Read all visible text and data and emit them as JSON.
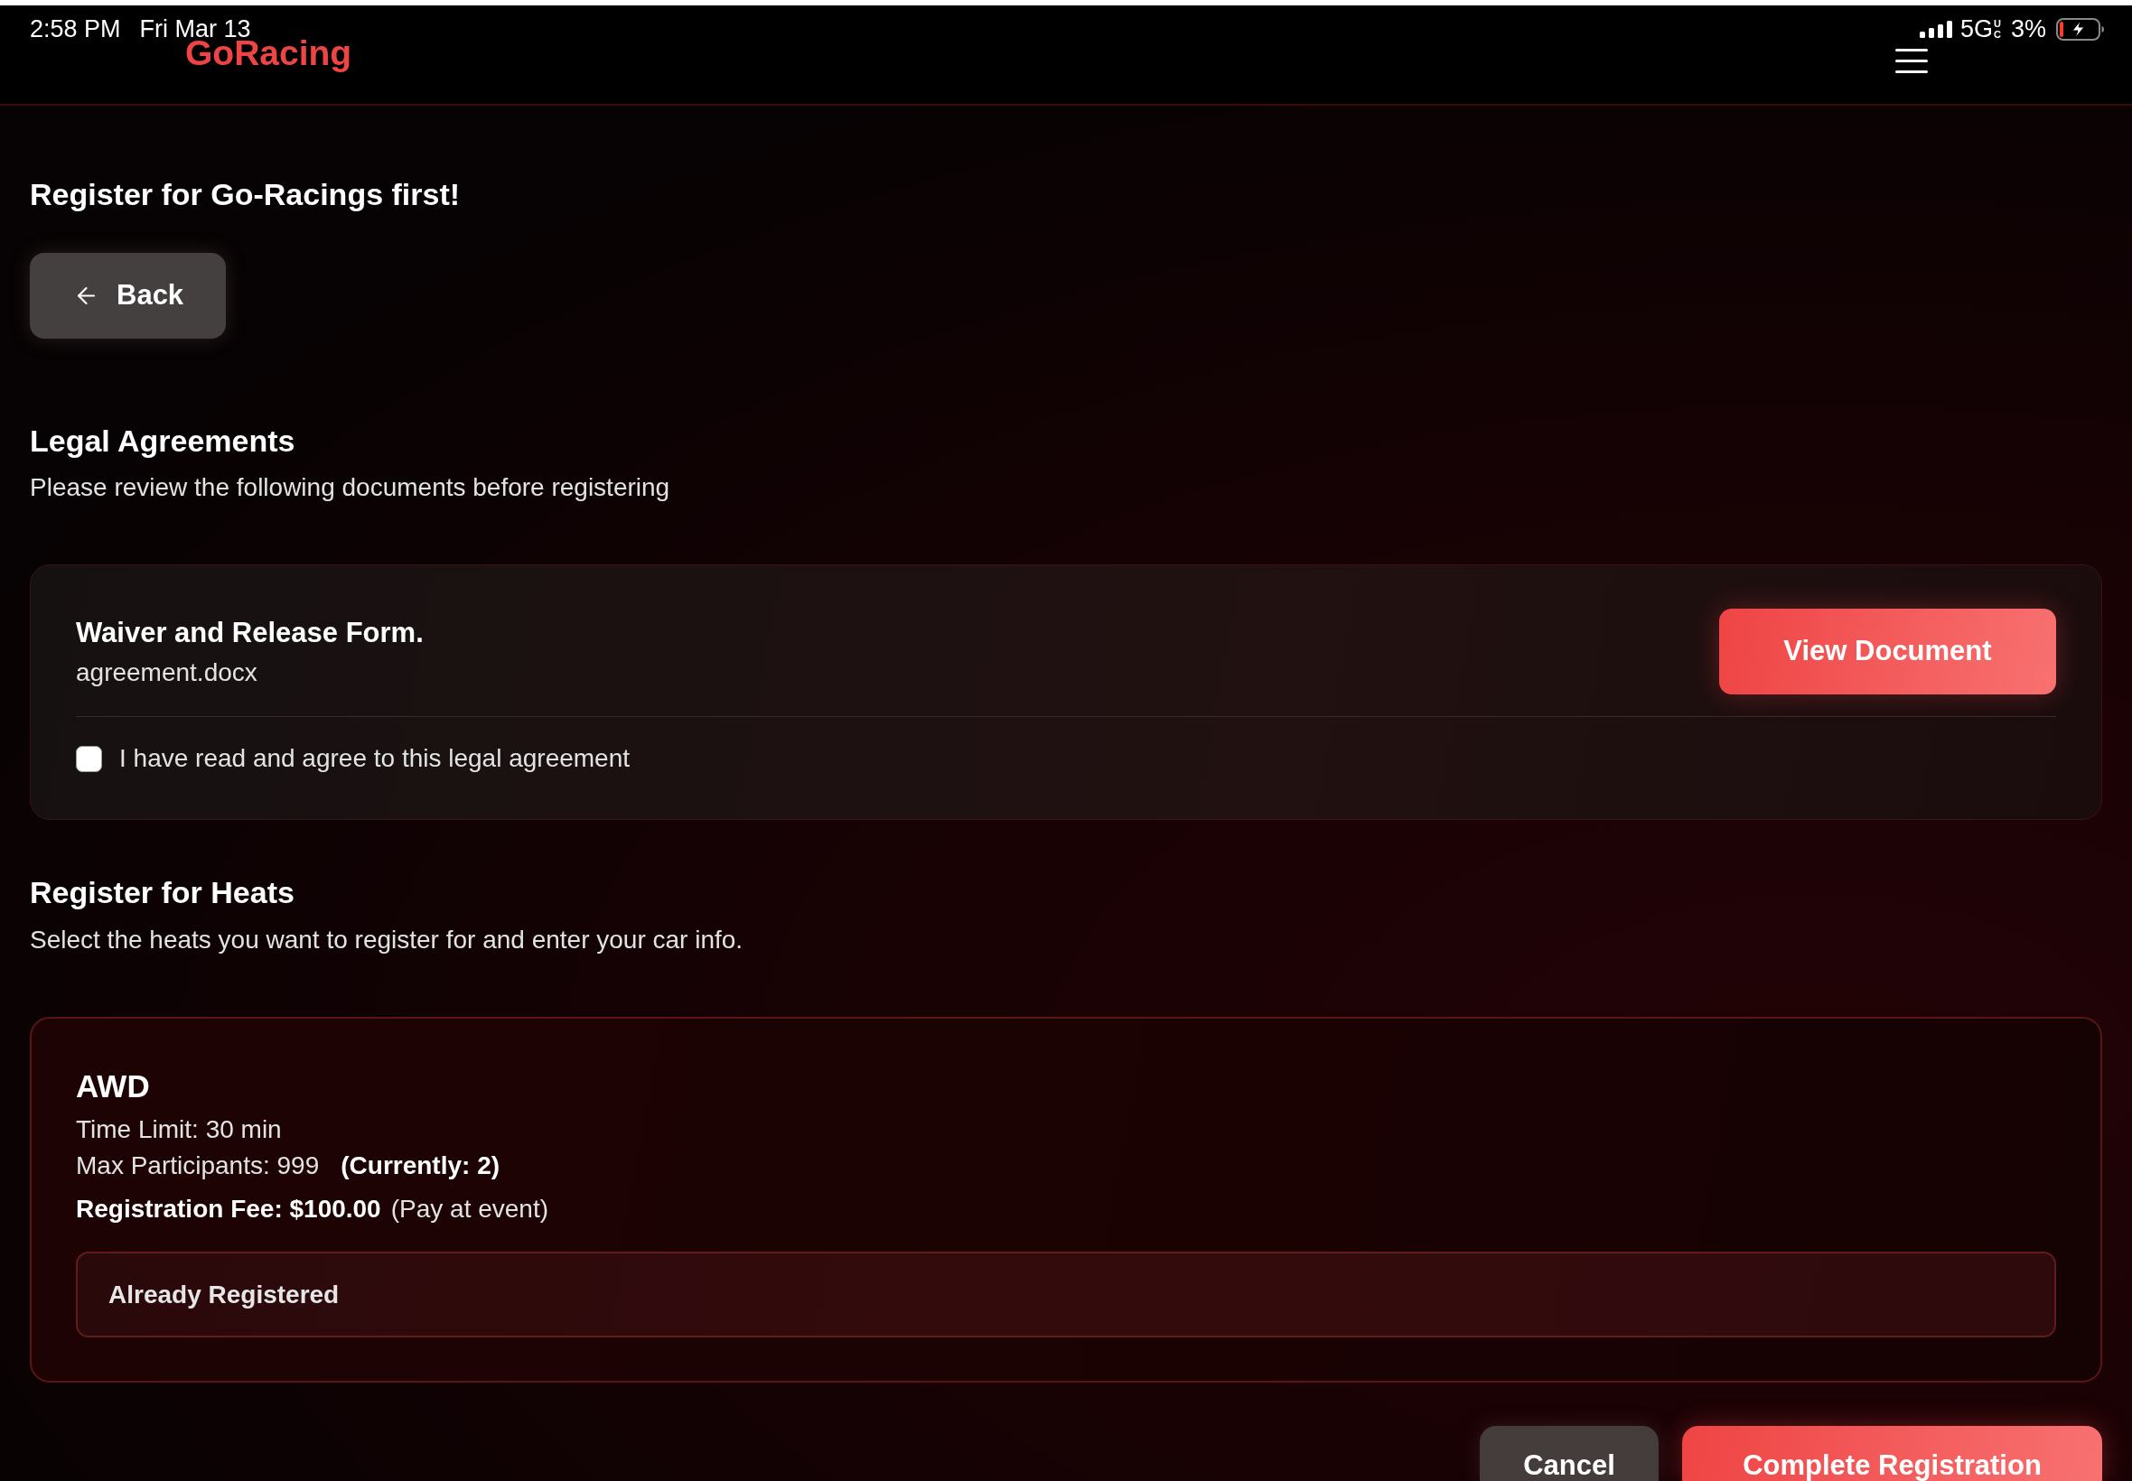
{
  "status_bar": {
    "time": "2:58 PM",
    "date": "Fri Mar 13",
    "network": "5G",
    "network_suffix": "UC",
    "battery": "3%"
  },
  "header": {
    "logo": "GoRacing"
  },
  "page": {
    "title": "Register for Go-Racings first!",
    "back_button": "Back"
  },
  "legal": {
    "title": "Legal Agreements",
    "subtitle": "Please review the following documents before registering",
    "documents": [
      {
        "name": "Waiver and Release Form.",
        "file": "agreement.docx",
        "button": "View Document",
        "agree_label": "I have read and agree to this legal agreement",
        "checked": false
      }
    ]
  },
  "heats": {
    "title": "Register for Heats",
    "subtitle": "Select the heats you want to register for and enter your car info.",
    "items": [
      {
        "name": "AWD",
        "time_limit": "Time Limit: 30 min",
        "max_participants": "Max Participants: 999",
        "current": "(Currently: 2)",
        "fee": "Registration Fee: $100.00",
        "fee_note": "(Pay at event)",
        "status": "Already Registered",
        "registered": true
      }
    ]
  },
  "actions": [
    {
      "label": "Cancel",
      "kind": "secondary"
    },
    {
      "label": "Complete Registration",
      "kind": "primary"
    }
  ]
}
